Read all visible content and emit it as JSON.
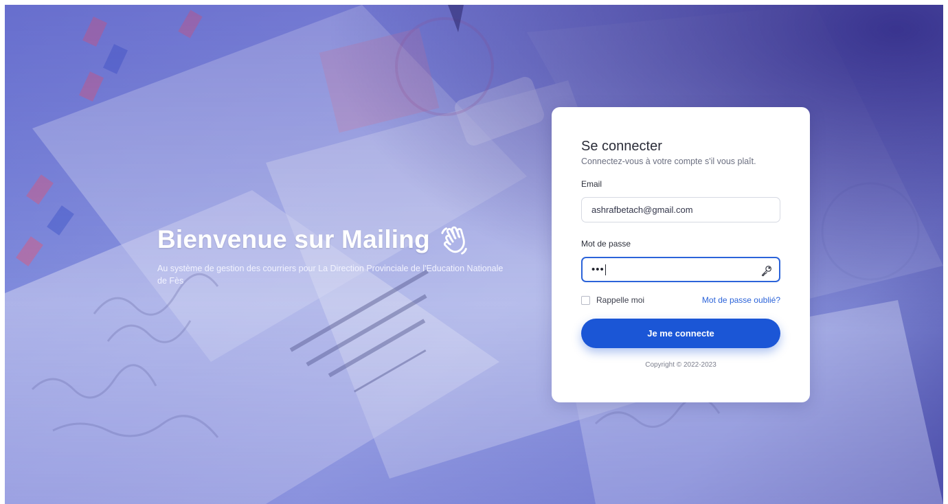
{
  "hero": {
    "title": "Bienvenue sur Mailing",
    "subtitle": "Au système de gestion des courriers pour La Direction Provinciale de l'Education Nationale de Fès",
    "icon": "waving-hand-icon"
  },
  "login": {
    "title": "Se connecter",
    "subtitle": "Connectez-vous à votre compte s'il vous plaît.",
    "email_label": "Email",
    "email_value": "ashrafbetach@gmail.com",
    "password_label": "Mot de passe",
    "password_value": "•••",
    "password_icon": "key-icon",
    "remember_label": "Rappelle moi",
    "forgot_label": "Mot de passe oublié?",
    "submit_label": "Je me connecte",
    "copyright": "Copyright © 2022-2023"
  },
  "colors": {
    "primary": "#1b56d6",
    "link": "#2b63d9",
    "background_tint": "#7d86d4"
  }
}
